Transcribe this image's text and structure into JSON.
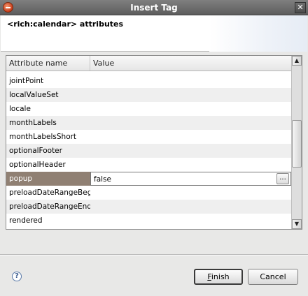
{
  "window": {
    "title": "Insert Tag",
    "close_glyph": "✕",
    "icon": "app-icon"
  },
  "banner": {
    "title": "<rich:calendar> attributes"
  },
  "table": {
    "columns": [
      "Attribute name",
      "Value"
    ],
    "rows": [
      {
        "name": "jointPoint",
        "value": ""
      },
      {
        "name": "localValueSet",
        "value": ""
      },
      {
        "name": "locale",
        "value": ""
      },
      {
        "name": "monthLabels",
        "value": ""
      },
      {
        "name": "monthLabelsShort",
        "value": ""
      },
      {
        "name": "optionalFooter",
        "value": ""
      },
      {
        "name": "optionalHeader",
        "value": ""
      },
      {
        "name": "popup",
        "value": "false",
        "selected": true,
        "button": "..."
      },
      {
        "name": "preloadDateRangeBeg",
        "value": ""
      },
      {
        "name": "preloadDateRangeEnd",
        "value": ""
      },
      {
        "name": "rendered",
        "value": ""
      }
    ]
  },
  "scrollbar": {
    "up": "▲",
    "down": "▼"
  },
  "footer": {
    "help": "?",
    "finish_first": "F",
    "finish_rest": "inish",
    "cancel": "Cancel"
  }
}
